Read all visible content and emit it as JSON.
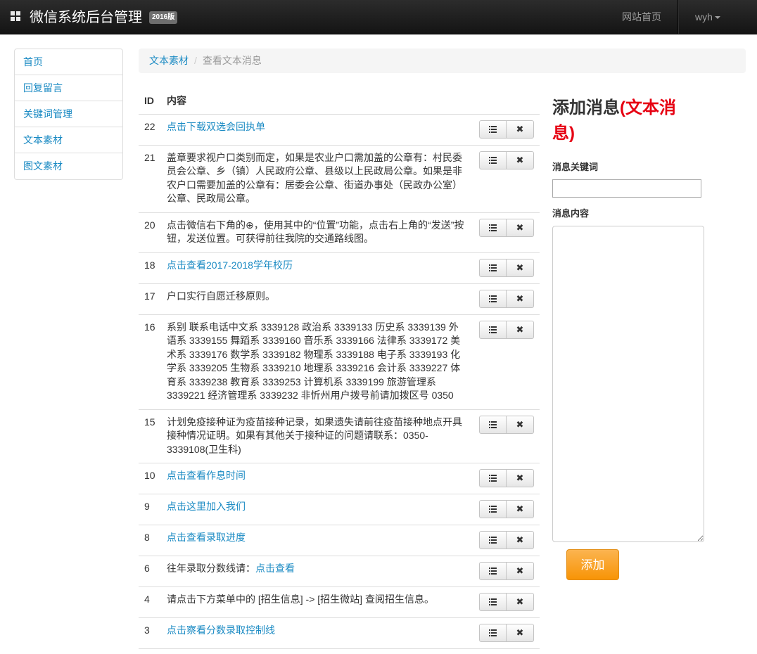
{
  "navbar": {
    "brand": "微信系统后台管理",
    "version_badge": "2016版",
    "home_link": "网站首页",
    "user": "wyh"
  },
  "sidebar": {
    "items": [
      {
        "label": "首页"
      },
      {
        "label": "回复留言"
      },
      {
        "label": "关键词管理"
      },
      {
        "label": "文本素材"
      },
      {
        "label": "图文素材"
      }
    ]
  },
  "breadcrumb": {
    "parent": "文本素材",
    "separator": "/",
    "current": "查看文本消息"
  },
  "table": {
    "headers": {
      "id": "ID",
      "content": "内容"
    },
    "rows": [
      {
        "id": "22",
        "text": "",
        "link": "点击下载双选会回执单"
      },
      {
        "id": "21",
        "text": "盖章要求视户口类别而定，如果是农业户口需加盖的公章有：村民委员会公章、乡（镇）人民政府公章、县级以上民政局公章。如果是非农户口需要加盖的公章有：居委会公章、街道办事处（民政办公室）公章、民政局公章。",
        "link": ""
      },
      {
        "id": "20",
        "text": "点击微信右下角的⊕，使用其中的“位置”功能，点击右上角的“发送”按钮，发送位置。可获得前往我院的交通路线图。",
        "link": ""
      },
      {
        "id": "18",
        "text": "",
        "link": "点击查看2017-2018学年校历"
      },
      {
        "id": "17",
        "text": "户口实行自愿迁移原则。",
        "link": ""
      },
      {
        "id": "16",
        "text": "系别 联系电话中文系 3339128 政治系 3339133 历史系 3339139 外语系 3339155 舞蹈系 3339160 音乐系 3339166 法律系 3339172 美术系 3339176 数学系 3339182 物理系 3339188 电子系 3339193 化学系 3339205 生物系 3339210 地理系 3339216 会计系 3339227 体育系 3339238 教育系 3339253 计算机系 3339199 旅游管理系 3339221 经济管理系 3339232 非忻州用户拨号前请加拨区号 0350",
        "link": ""
      },
      {
        "id": "15",
        "text": "计划免疫接种证为疫苗接种记录，如果遗失请前往疫苗接种地点开具接种情况证明。如果有其他关于接种证的问题请联系：0350-3339108(卫生科)",
        "link": ""
      },
      {
        "id": "10",
        "text": "",
        "link": "点击查看作息时间"
      },
      {
        "id": "9",
        "text": "",
        "link": "点击这里加入我们"
      },
      {
        "id": "8",
        "text": "",
        "link": "点击查看录取进度"
      },
      {
        "id": "6",
        "text": "往年录取分数线请：",
        "link": "点击查看"
      },
      {
        "id": "4",
        "text": "请点击下方菜单中的 [招生信息] -> [招生微站] 查阅招生信息。",
        "link": ""
      },
      {
        "id": "3",
        "text": "",
        "link": "点击察看分数录取控制线"
      }
    ],
    "action_icons": [
      "list-icon",
      "close-icon"
    ]
  },
  "form": {
    "title": "添加消息",
    "title_highlight": "(文本消息)",
    "keyword_label": "消息关键词",
    "keyword_value": "",
    "content_label": "消息内容",
    "content_value": "",
    "submit_label": "添加"
  },
  "colors": {
    "navbar": "#222222",
    "link": "#1a8ac3",
    "title_highlight": "#e60012",
    "add_button": "#f89406"
  }
}
